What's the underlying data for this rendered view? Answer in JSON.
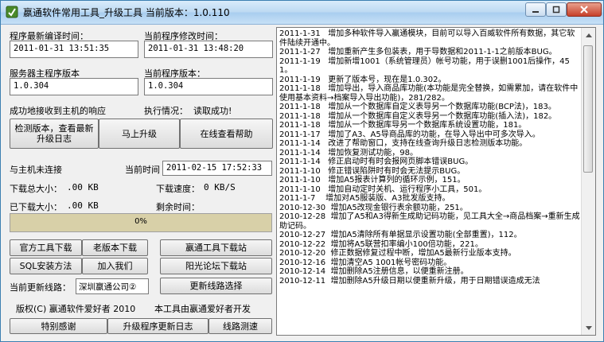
{
  "window": {
    "title": "嬴通软件常用工具_升级工具  当前版本：1.0.110"
  },
  "info": {
    "compile_time_label": "程序最新编译时间：",
    "compile_time_value": "2011-01-31 13:51:35",
    "modify_time_label": "当前程序修改时间：",
    "modify_time_value": "2011-01-31 13:48:20",
    "server_version_label": "服务器主程序版本",
    "server_version_value": "1.0.304",
    "current_version_label": "当前程序版本：",
    "current_version_value": "1.0.304",
    "response_text": "成功地接收到主机的响应",
    "exec_label": "执行情况：",
    "exec_value": "读取成功!"
  },
  "actions": {
    "check_label": "检测版本，查看最新升级日志",
    "upgrade_label": "马上升级",
    "help_label": "在线查看帮助"
  },
  "download": {
    "host_status": "与主机未连接",
    "time_label": "当前时间",
    "time_value": "2011-02-15 17:52:33",
    "total_label": "下载总大小：",
    "total_value": ".00 KB",
    "speed_label": "下载速度：",
    "speed_value": "0 KB/S",
    "downloaded_label": "已下载大小：",
    "downloaded_value": ".00 KB",
    "remaining_label": "剩余时间：",
    "remaining_value": "",
    "progress_percent": 0,
    "progress_text": "0%"
  },
  "links": {
    "official_tools": "官方工具下载",
    "old_version": "老版本下载",
    "yingtong_tools": "嬴通工具下载站",
    "sql_install": "SQL安装方法",
    "join_us": "加入我们",
    "yangguang_forum": "阳光论坛下载站",
    "route_label": "当前更新线路：",
    "route_value": "深圳嬴通公司②",
    "route_select": "更新线路选择"
  },
  "footer": {
    "copyright": "版权(C) 嬴通软件爱好者 2010",
    "made_by": "本工具由嬴通爱好者开发",
    "thanks": "特别感谢",
    "changelog": "升级程序更新日志",
    "route_test": "线路测速"
  },
  "log": [
    "2011-1-31   增加多种软件导入嬴通模块，目前可以导入百威软件所有数据，其它软件陆续开通中。",
    "2011-1-27   增加重新产生多包装表，用于导数据和2011-1-1之前版本BUG。",
    "2011-1-19   增加新增1001（系统管理员）帐号功能，用于误删1001后操作，451。",
    "2011-1-19   更新了版本号，现在是1.0.302。",
    "2011-1-18   增加导出，导入商品库功能(本功能是完全替换，如需累加，请在软件中使用基本资料→档案导入导出功能)，281/282。",
    "2011-1-18   增加从一个数据库自定义表导另一个数据库功能(BCP法)，183。",
    "2011-1-18   增加从一个数据库自定义表导另一个数据库功能(插入法)，182。",
    "2011-1-18   增加从一个数据库导另一个数据库系统设置功能，181。",
    "2011-1-17   增加了A3、A5导商品库的功能，在导入导出中可多次导入。",
    "2011-1-14   改进了帮助窗口，支持在线查询升级日志检测版本功能。",
    "2011-1-14   增加恢复测试功能，98。",
    "2011-1-14   修正启动时有时会报网页脚本错误BUG。",
    "2011-1-10   修正错误陷阱时有时会无法提示BUG。",
    "2011-1-10   增加A5报表计算列的循环示例，151。",
    "2011-1-10   增加自动定时关机、运行程序小工具，501。",
    "2011-1-7    增加对A5服装版、A3批发版支持。",
    "2010-12-30  增加A5改现金银行表余额功能，251。",
    "2010-12-28  增加了A5和A3得新生成助记码功能，见工具大全→商品档案→重新生成助记码。",
    "2010-12-27  增加A5清除所有单据显示设置功能(全部重置)，112。",
    "2010-12-22  增加将A5联营扣率编小100倍功能，221。",
    "2010-12-20  修正数据修复过程中断，增加A5最新行业版本支持。",
    "2010-12-16  增加清空A5 1001帐号密码功能。",
    "2010-12-14  增加删除A5注册信息，以便重新注册。",
    "2010-12-11  增加删除A5升级日期以便重新升级，用于日期错误造成无法"
  ]
}
